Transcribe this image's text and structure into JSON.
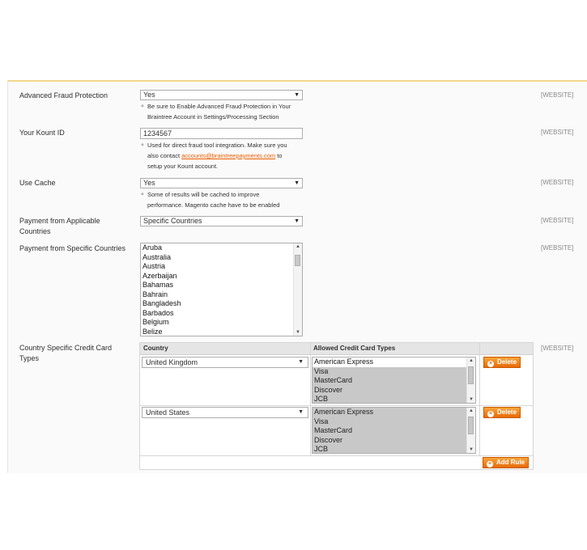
{
  "form": {
    "cut_text": "",
    "advanced_fraud": {
      "label": "Advanced Fraud Protection",
      "value": "Yes",
      "note_line1": "Be sure to Enable Advanced Fraud Protection in Your",
      "note_line2": "Braintree Account in Settings/Processing Section",
      "scope": "[WEBSITE]"
    },
    "kount_id": {
      "label": "Your Kount ID",
      "value": "1234567",
      "note_line1": "Used for direct fraud tool integration. Make sure you",
      "note_line2_prefix": "also contact ",
      "note_link": "accounts@braintreepayments.com",
      "note_line2_suffix": " to",
      "note_line3": "setup your Kount account.",
      "scope": "[WEBSITE]"
    },
    "use_cache": {
      "label": "Use Cache",
      "value": "Yes",
      "note_line1": "Some of results will be cached to improve",
      "note_line2": "performance. Magento cache have to be enabled",
      "scope": "[WEBSITE]"
    },
    "applicable_countries": {
      "label_line1": "Payment from Applicable",
      "label_line2": "Countries",
      "value": "Specific Countries",
      "scope": "[WEBSITE]"
    },
    "specific_countries": {
      "label": "Payment from Specific Countries",
      "options": [
        "Aruba",
        "Australia",
        "Austria",
        "Azerbaijan",
        "Bahamas",
        "Bahrain",
        "Bangladesh",
        "Barbados",
        "Belgium",
        "Belize"
      ],
      "scope": "[WEBSITE]"
    },
    "card_types": {
      "label_line1": "Country Specific Credit Card",
      "label_line2": "Types",
      "col_country": "Country",
      "col_allowed": "Allowed Credit Card Types",
      "rows": [
        {
          "country": "United Kingdom",
          "cards": [
            "American Express",
            "Visa",
            "MasterCard",
            "Discover",
            "JCB"
          ]
        },
        {
          "country": "United States",
          "cards": [
            "American Express",
            "Visa",
            "MasterCard",
            "Discover",
            "JCB"
          ]
        }
      ],
      "delete_label": "Delete",
      "add_rule_label": "Add Rule",
      "scope": "[WEBSITE]"
    }
  },
  "icons": {
    "dropdown": "triangle-down",
    "delete": "x-circle",
    "add": "plus-circle",
    "note": "triangle-up"
  },
  "colors": {
    "accent": "#eb5e00",
    "button": "#f18200",
    "header_border": "#f0d88a"
  }
}
